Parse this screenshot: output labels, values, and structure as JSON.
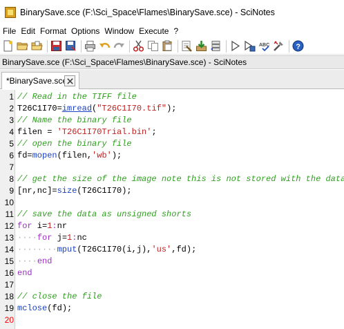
{
  "window": {
    "title": "BinarySave.sce (F:\\Sci_Space\\Flames\\BinarySave.sce) - SciNotes"
  },
  "menu": [
    "File",
    "Edit",
    "Format",
    "Options",
    "Window",
    "Execute",
    "?"
  ],
  "toolbar": {
    "icons": [
      "new-file-icon",
      "open-folder-icon",
      "open-file-icon",
      "save-icon",
      "save-as-icon",
      "print-icon",
      "undo-icon",
      "redo-icon",
      "cut-icon",
      "copy-icon",
      "paste-icon",
      "find-icon",
      "execute-icon",
      "step-icon",
      "run-icon",
      "run-save-icon",
      "abc-icon",
      "settings-icon",
      "help-icon"
    ]
  },
  "pathbar": {
    "text": "BinarySave.sce (F:\\Sci_Space\\Flames\\BinarySave.sce) - SciNotes"
  },
  "tab": {
    "label": "*BinarySave.sce"
  },
  "editor": {
    "current_line": 20,
    "lines": [
      {
        "n": "1"
      },
      {
        "n": "2"
      },
      {
        "n": "3"
      },
      {
        "n": "4"
      },
      {
        "n": "5"
      },
      {
        "n": "6"
      },
      {
        "n": "7"
      },
      {
        "n": "8"
      },
      {
        "n": "9"
      },
      {
        "n": "10"
      },
      {
        "n": "11"
      },
      {
        "n": "12"
      },
      {
        "n": "13"
      },
      {
        "n": "14"
      },
      {
        "n": "15"
      },
      {
        "n": "16"
      },
      {
        "n": "17"
      },
      {
        "n": "18"
      },
      {
        "n": "19"
      },
      {
        "n": "20"
      }
    ],
    "code": {
      "l1": "// Read in the TIFF file",
      "l2_var": "T26C1I70=",
      "l2_fn": "imread",
      "l2_open": "(",
      "l2_str": "\"T26C1I70.tif\"",
      "l2_close": ");",
      "l3": "// Name the binary file",
      "l4_var": "filen = ",
      "l4_str": "'T26C1I70Trial.bin'",
      "l4_end": ";",
      "l5": "// open the binary file",
      "l6_var": "fd=",
      "l6_fn": "mopen",
      "l6_mid": "(filen,",
      "l6_str": "'wb'",
      "l6_end": ");",
      "l8": "// get the size of the image note this is not stored with the data",
      "l9_var": "[nr,nc]=",
      "l9_fn": "size",
      "l9_end": "(T26C1I70);",
      "l11": "// save the data as unsigned shorts",
      "l12_kw": "for",
      "l12_a": " i=",
      "l12_n1": "1",
      "l12_colon": ":",
      "l12_b": "nr",
      "l13_indent": "····",
      "l13_kw": "for",
      "l13_a": " j=",
      "l13_n1": "1",
      "l13_colon": ":",
      "l13_b": "nc",
      "l14_indent": "········",
      "l14_fn": "mput",
      "l14_mid": "(T26C1I70(i,j),",
      "l14_str": "'us'",
      "l14_end": ",fd);",
      "l15_indent": "····",
      "l15_kw": "end",
      "l16_kw": "end",
      "l18": "// close the file",
      "l19_fn": "mclose",
      "l19_end": "(fd);"
    }
  }
}
